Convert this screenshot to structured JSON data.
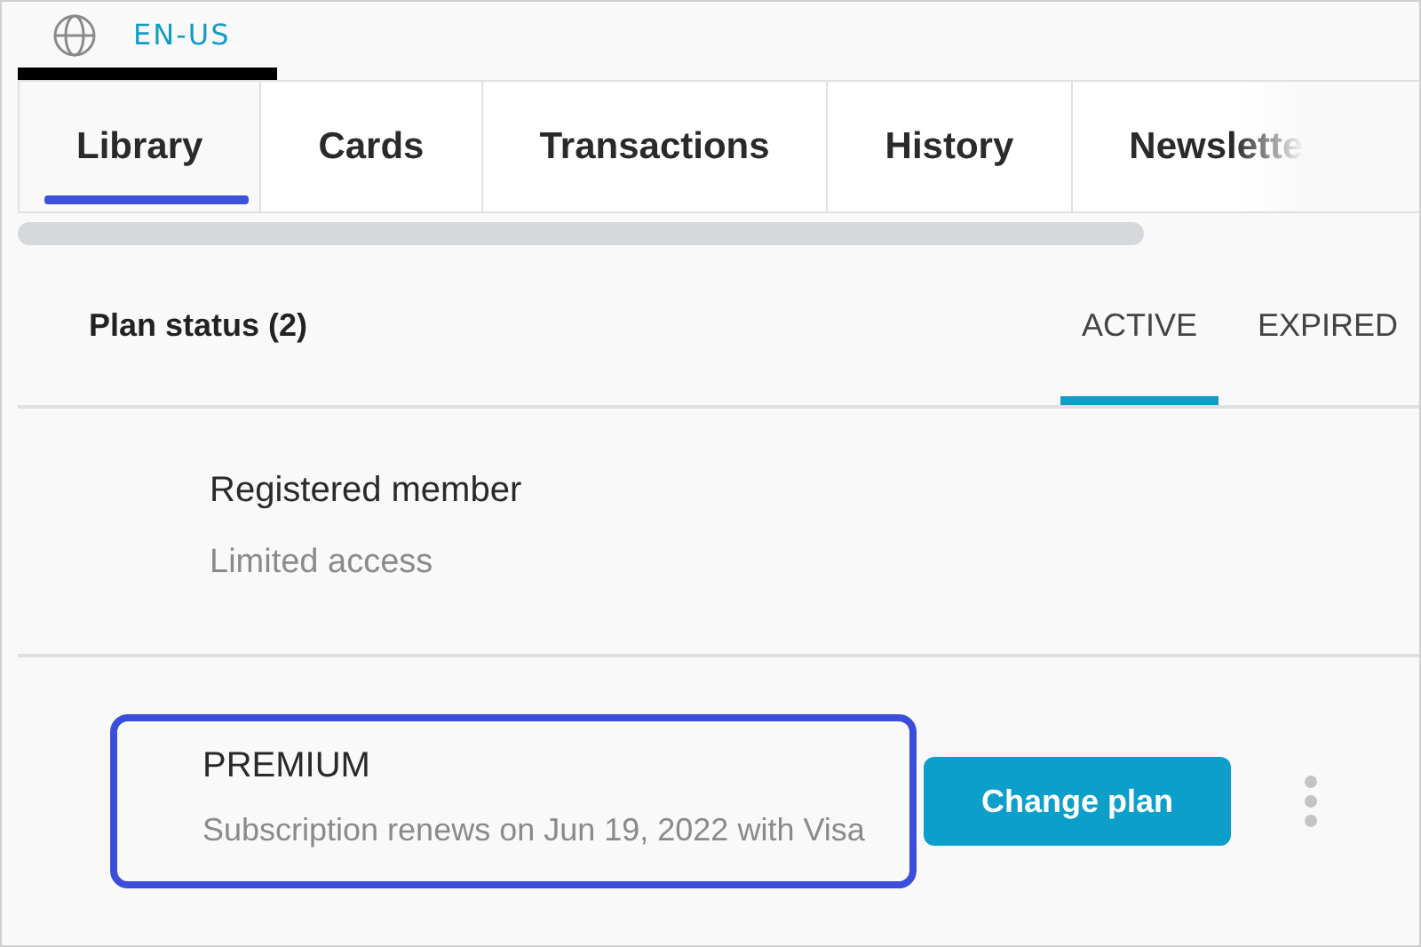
{
  "language": {
    "label": "EN-US"
  },
  "tabs": [
    {
      "label": "Library",
      "selected": true
    },
    {
      "label": "Cards",
      "selected": false
    },
    {
      "label": "Transactions",
      "selected": false
    },
    {
      "label": "History",
      "selected": false
    },
    {
      "label": "Newslette",
      "selected": false
    }
  ],
  "plan_status": {
    "title": "Plan status (2)",
    "filters": [
      {
        "label": "ACTIVE",
        "selected": true
      },
      {
        "label": "EXPIRED",
        "selected": false
      }
    ]
  },
  "plans": [
    {
      "name": "Registered member",
      "description": "Limited access",
      "highlighted": false
    },
    {
      "name": "PREMIUM",
      "description": "Subscription renews on Jun 19, 2022 with Visa",
      "highlighted": true,
      "action": "Change plan",
      "more_menu": true
    }
  ]
}
